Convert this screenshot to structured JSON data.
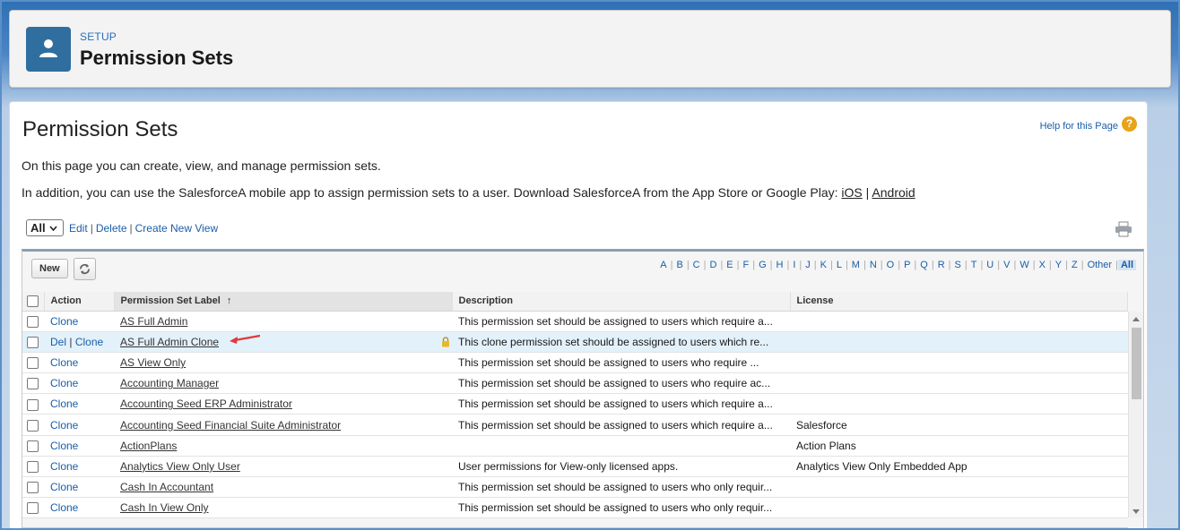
{
  "header": {
    "eyebrow": "SETUP",
    "title": "Permission Sets",
    "icon": "user-icon"
  },
  "main": {
    "title": "Permission Sets",
    "help_label": "Help for this Page",
    "intro": "On this page you can create, view, and manage permission sets.",
    "mobile_text": "In addition, you can use the SalesforceA mobile app to assign permission sets to a user. Download SalesforceA from the App Store or Google Play:",
    "ios_label": "iOS",
    "pipe": "|",
    "android_label": "Android"
  },
  "view": {
    "selected": "All",
    "edit": "Edit",
    "delete": "Delete",
    "create": "Create New View"
  },
  "toolbar": {
    "new_label": "New"
  },
  "alphabet": [
    "A",
    "B",
    "C",
    "D",
    "E",
    "F",
    "G",
    "H",
    "I",
    "J",
    "K",
    "L",
    "M",
    "N",
    "O",
    "P",
    "Q",
    "R",
    "S",
    "T",
    "U",
    "V",
    "W",
    "X",
    "Y",
    "Z",
    "Other",
    "All"
  ],
  "columns": {
    "action": "Action",
    "label": "Permission Set Label",
    "sort_indicator": "↑",
    "description": "Description",
    "license": "License"
  },
  "rows": [
    {
      "actions": "Clone",
      "label": "AS Full Admin",
      "description": "This permission set should be assigned to users which require a...",
      "license": ""
    },
    {
      "actions": "Del | Clone",
      "label": "AS Full Admin Clone",
      "description": "This clone permission set should be assigned to users which re...",
      "license": "",
      "locked": true,
      "highlighted": true
    },
    {
      "actions": "Clone",
      "label": "AS View Only",
      "description": "This permission set should be assigned to users who require ...",
      "license": ""
    },
    {
      "actions": "Clone",
      "label": "Accounting Manager",
      "description": "This permission set should be assigned to users who require ac...",
      "license": ""
    },
    {
      "actions": "Clone",
      "label": "Accounting Seed ERP Administrator",
      "description": "This permission set should be assigned to users which require a...",
      "license": ""
    },
    {
      "actions": "Clone",
      "label": "Accounting Seed Financial Suite Administrator",
      "description": "This permission set should be assigned to users which require a...",
      "license": "Salesforce"
    },
    {
      "actions": "Clone",
      "label": "ActionPlans",
      "description": "",
      "license": "Action Plans"
    },
    {
      "actions": "Clone",
      "label": "Analytics View Only User",
      "description": "User permissions for View-only licensed apps.",
      "license": "Analytics View Only Embedded App"
    },
    {
      "actions": "Clone",
      "label": "Cash In Accountant",
      "description": "This permission set should be assigned to users who only requir...",
      "license": ""
    },
    {
      "actions": "Clone",
      "label": "Cash In View Only",
      "description": "This permission set should be assigned to users who only requir...",
      "license": ""
    }
  ],
  "colors": {
    "link": "#1a5ea8",
    "header_icon_bg": "#2f6e9e",
    "highlight_row": "#e3f1fb",
    "help_icon": "#e8a317",
    "annotation_arrow": "#e03a3a"
  }
}
